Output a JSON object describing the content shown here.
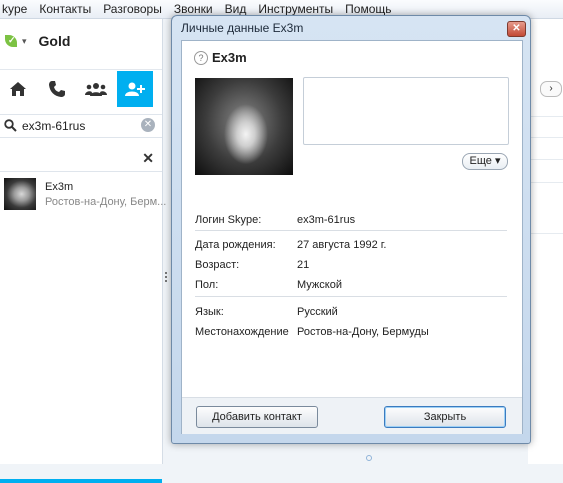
{
  "menu": [
    "kype",
    "Контакты",
    "Разговоры",
    "Звонки",
    "Вид",
    "Инструменты",
    "Помощь"
  ],
  "status": {
    "name": "Gold",
    "icon": "skype-status-online-icon"
  },
  "nav": [
    "home-icon",
    "phone-icon",
    "group-icon",
    "add-contact-icon"
  ],
  "search": {
    "value": "ex3m-61rus"
  },
  "contact": {
    "name": "Ex3m",
    "location": "Ростов-на-Дону, Берм..."
  },
  "dialog": {
    "title": "Личные данные Ex3m",
    "name": "Ex3m",
    "more_label": "Еще ▾",
    "fields": {
      "skype_login": {
        "label": "Логин Skype:",
        "value": "ex3m-61rus"
      },
      "birthday": {
        "label": "Дата рождения:",
        "value": "27 августа 1992 г."
      },
      "age": {
        "label": "Возраст:",
        "value": "21"
      },
      "gender": {
        "label": "Пол:",
        "value": "Мужской"
      },
      "language": {
        "label": "Язык:",
        "value": "Русский"
      },
      "location": {
        "label": "Местонахождение",
        "value": "Ростов-на-Дону, Бермуды"
      }
    },
    "add_contact_label": "Добавить контакт",
    "close_label": "Закрыть"
  },
  "colors": {
    "accent": "#00aff0",
    "status_green": "#7cc243"
  }
}
